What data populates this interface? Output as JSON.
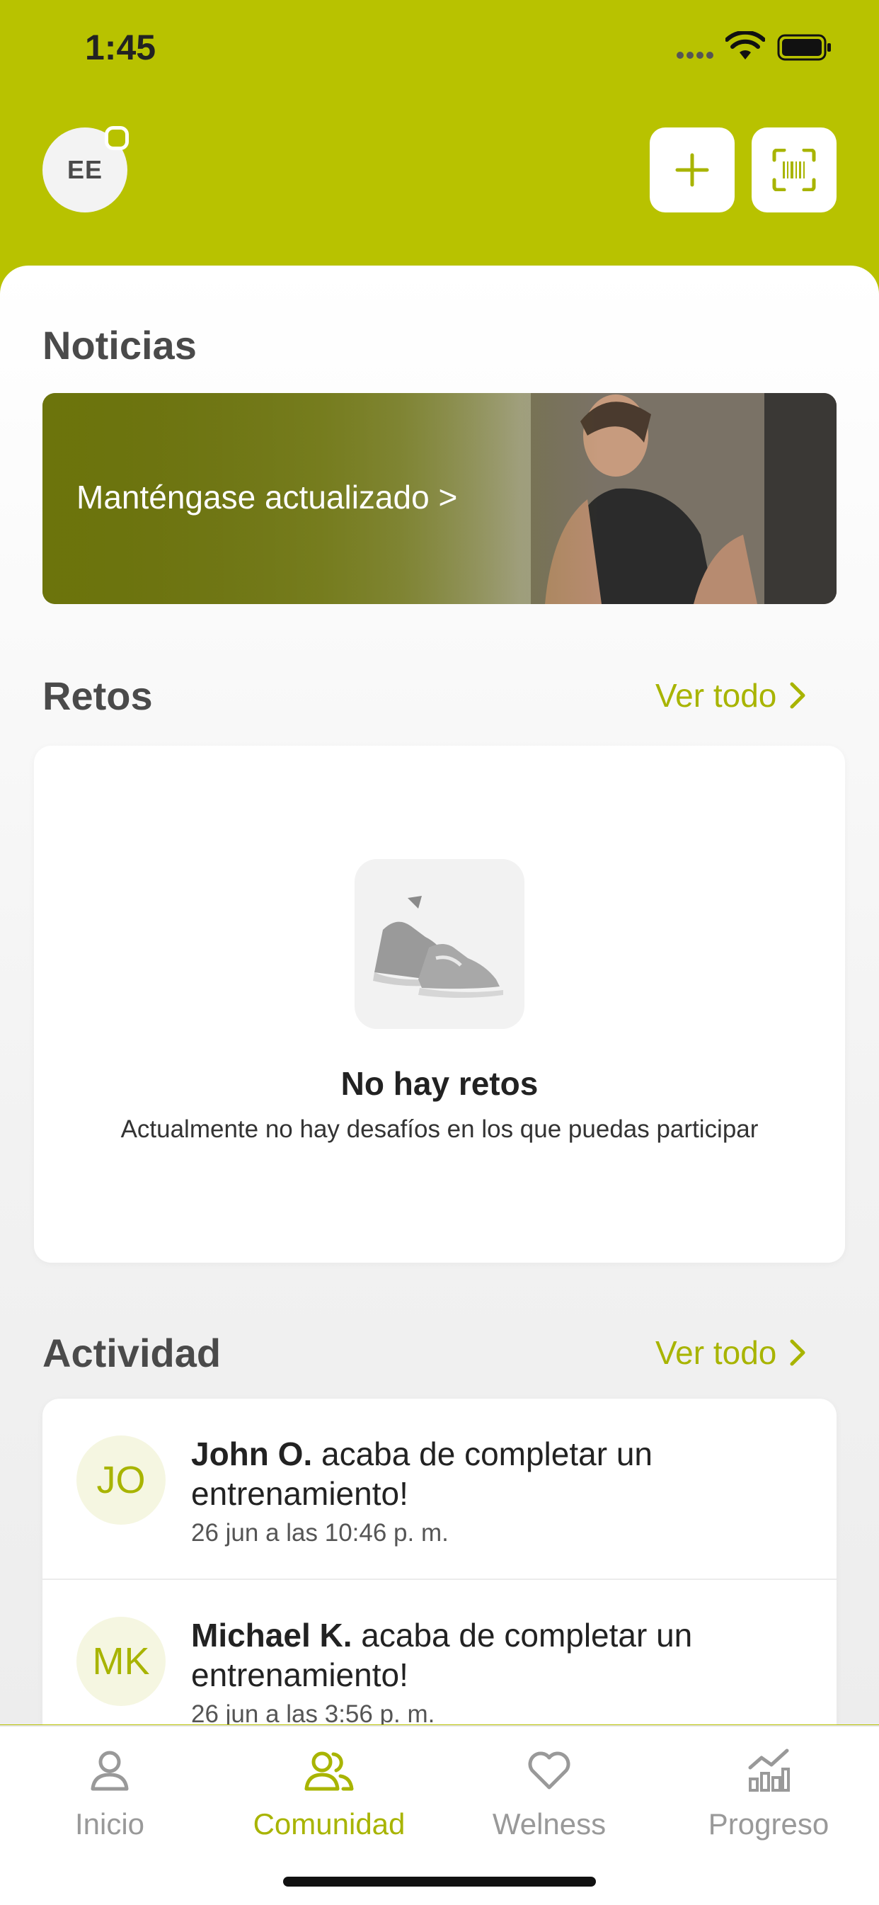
{
  "status_bar": {
    "time": "1:45"
  },
  "header": {
    "avatar_initials": "EE"
  },
  "news": {
    "title": "Noticias",
    "banner_text": "Manténgase actualizado >"
  },
  "challenges": {
    "title": "Retos",
    "see_all": "Ver todo",
    "empty_title": "No hay retos",
    "empty_description": "Actualmente no hay desafíos en los que puedas participar"
  },
  "activity": {
    "title": "Actividad",
    "see_all": "Ver todo",
    "items": [
      {
        "initials": "JO",
        "name": "John O.",
        "action": " acaba de completar un entrenamiento!",
        "time": "26 jun a las 10:46 p. m."
      },
      {
        "initials": "MK",
        "name": "Michael K.",
        "action": " acaba de completar un entrenamiento!",
        "time": "26 jun a las 3:56 p. m."
      }
    ]
  },
  "tabs": [
    {
      "label": "Inicio",
      "icon": "person-icon",
      "active": false
    },
    {
      "label": "Comunidad",
      "icon": "people-icon",
      "active": true
    },
    {
      "label": "Welness",
      "icon": "heart-icon",
      "active": false
    },
    {
      "label": "Progreso",
      "icon": "chart-icon",
      "active": false
    }
  ],
  "colors": {
    "accent": "#b8c200",
    "accent_text": "#a8b400",
    "inactive": "#999999"
  }
}
